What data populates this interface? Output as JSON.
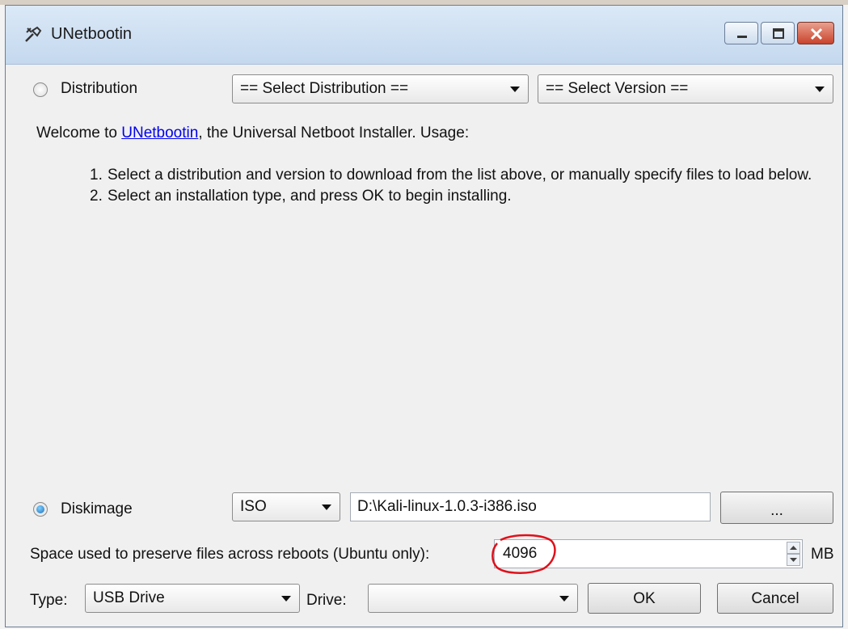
{
  "window": {
    "title": "UNetbootin"
  },
  "distribution": {
    "radio_label": "Distribution",
    "select_distribution": "== Select Distribution ==",
    "select_version": "== Select Version =="
  },
  "welcome": {
    "prefix": "Welcome to ",
    "link": "UNetbootin",
    "suffix": ", the Universal Netboot Installer. Usage:",
    "steps": [
      {
        "num": "1.",
        "text": "Select a distribution and version to download from the list above, or manually specify files to load below."
      },
      {
        "num": "2.",
        "text": "Select an installation type, and press OK to begin installing."
      }
    ]
  },
  "diskimage": {
    "radio_label": "Diskimage",
    "format": "ISO",
    "path": "D:\\Kali-linux-1.0.3-i386.iso",
    "browse_label": "..."
  },
  "persistence": {
    "label": "Space used to preserve files across reboots (Ubuntu only):",
    "value": "4096",
    "unit": "MB"
  },
  "bottom": {
    "type_label": "Type:",
    "type_value": "USB Drive",
    "drive_label": "Drive:",
    "drive_value": "",
    "ok_label": "OK",
    "cancel_label": "Cancel"
  },
  "colors": {
    "annotation": "#e0101a",
    "link": "#0000ee"
  },
  "icons": {
    "app": "wrench-icon",
    "minimize": "minimize-icon",
    "maximize": "maximize-icon",
    "close": "close-icon"
  }
}
